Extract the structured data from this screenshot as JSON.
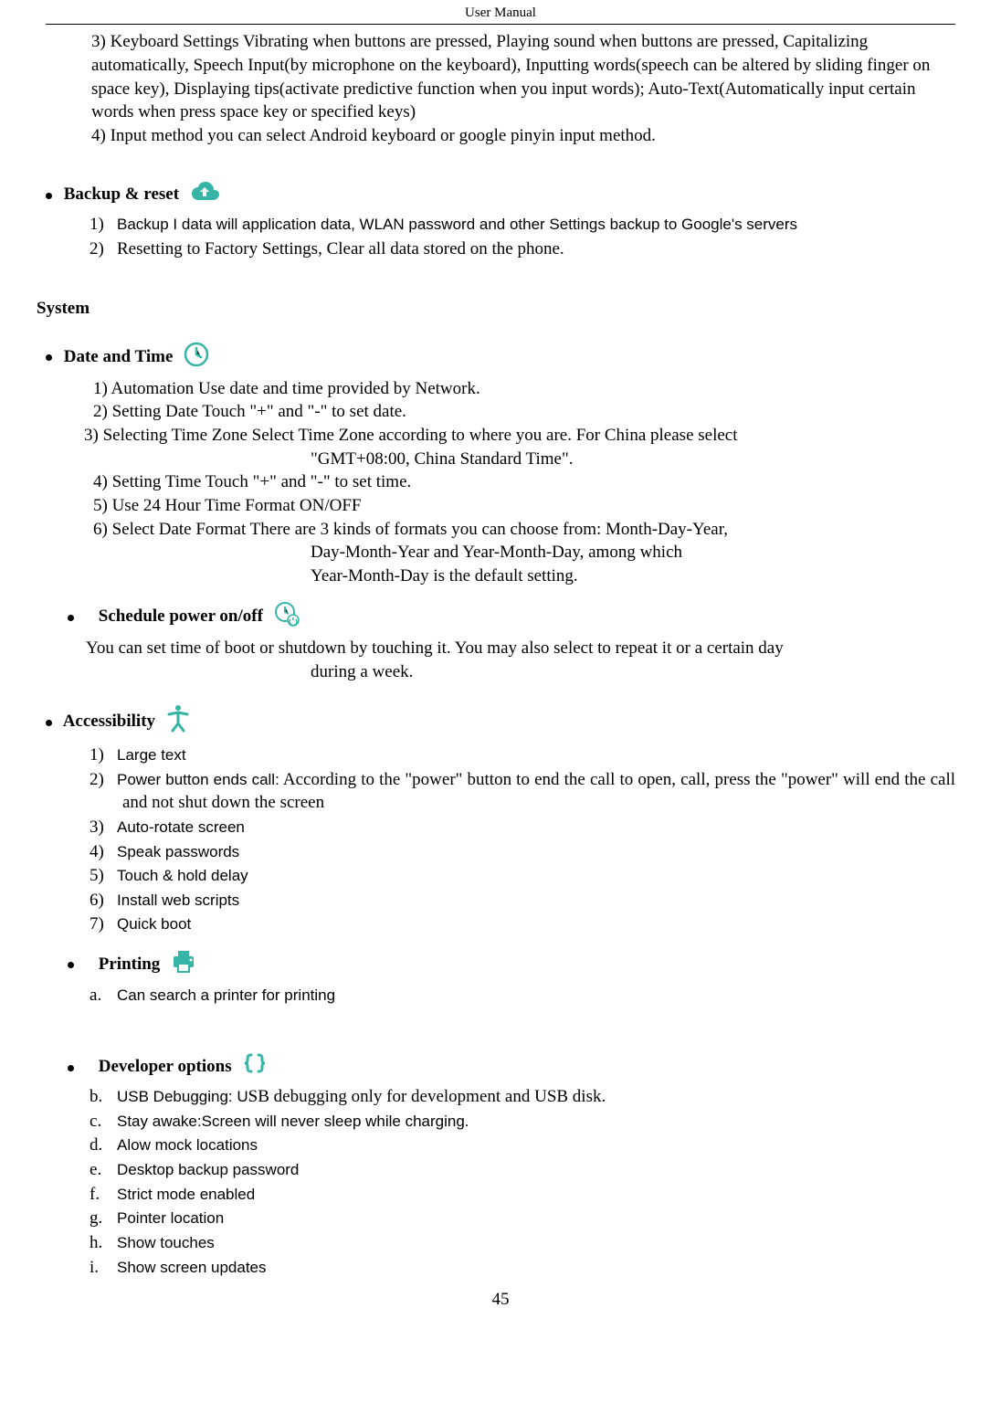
{
  "header": "User    Manual",
  "cont": {
    "keyboard": "3) Keyboard Settings        Vibrating when buttons are pressed, Playing sound when buttons are pressed, Capitalizing automatically, Speech Input(by microphone on the keyboard), Inputting words(speech can be altered by sliding finger on space key), Displaying tips(activate predictive function when you input words); Auto-Text(Automatically input certain words when press space key or specified keys)",
    "input_method": "4) Input method        you can select Android keyboard or google pinyin input method."
  },
  "backup": {
    "title": "Backup & reset",
    "items": [
      "Backup I data will application data, WLAN password and other Settings backup to Google's servers",
      "Resetting to Factory Settings, Clear all data stored on the phone."
    ]
  },
  "system": "System",
  "date_time": {
    "title": "Date and Time",
    "l1": "1) Automation        Use date and time provided by Network.",
    "l2": "2) Setting Date        Touch \"+\" and \"-\" to set date.",
    "l3": "3) Selecting Time Zone        Select Time Zone according to where you are. For China please select",
    "l3b": "\"GMT+08:00, China Standard Time\".",
    "l4": "4) Setting Time        Touch \"+\" and \"-\" to set time.",
    "l5": "5) Use 24 Hour Time Format        ON/OFF",
    "l6a": "6) Select Date Format     There are 3 kinds of formats you can choose from: Month-Day-Year,",
    "l6b": "Day-Month-Year     and     Year-Month-Day,     among     which",
    "l6c": "Year-Month-Day is the default setting."
  },
  "schedule": {
    "title": "Schedule power on/off",
    "desc_a": "You can set time of boot or shutdown by touching it. You may also select to repeat it or a certain day",
    "desc_b": "during a week."
  },
  "accessibility": {
    "title": "Accessibility",
    "items": [
      "Large text",
      "Power button ends call: According to the \"power\" button to end the call to open, call, press the \"power\" will end the call and not shut down the screen",
      "Auto-rotate screen",
      "Speak passwords",
      "Touch & hold delay",
      "Install web scripts",
      "Quick boot"
    ]
  },
  "printing": {
    "title": "Printing",
    "item": "Can search a printer for printing"
  },
  "developer": {
    "title": "Developer    options",
    "items": [
      "USB Debugging: USB debugging only for development and USB disk.",
      "Stay awake:Screen will never sleep while charging.",
      "Alow mock locations",
      "Desktop backup password",
      "Strict mode enabled",
      "Pointer location",
      "Show touches",
      "Show screen updates"
    ]
  },
  "page_number": "45"
}
